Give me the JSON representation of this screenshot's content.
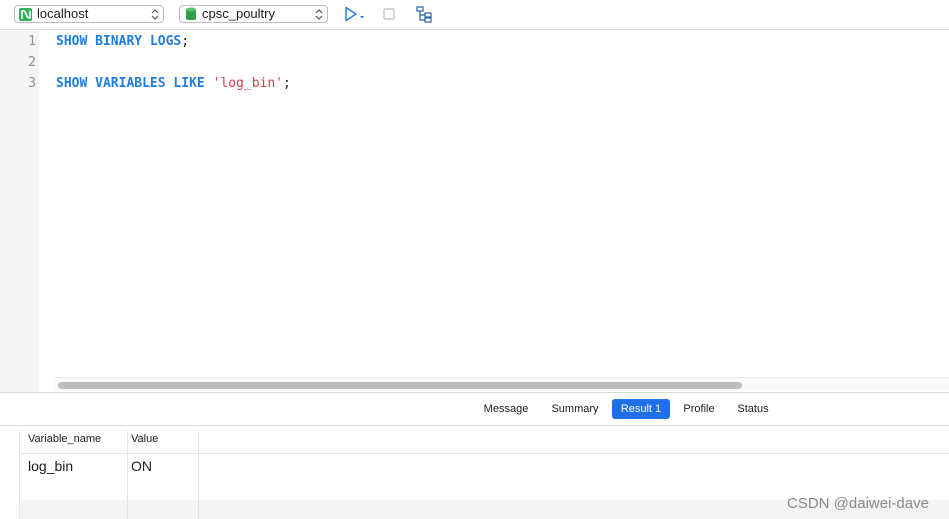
{
  "toolbar": {
    "connection": "localhost",
    "database": "cpsc_poultry",
    "icons": [
      "connection-icon",
      "database-icon",
      "run-icon",
      "stop-icon",
      "explain-icon"
    ]
  },
  "editor": {
    "line_numbers": [
      "1",
      "2",
      "3"
    ],
    "line1": {
      "kw1": "SHOW",
      "kw2": "BINARY",
      "kw3": "LOGS",
      "end": ";"
    },
    "line3": {
      "kw1": "SHOW",
      "kw2": "VARIABLES",
      "kw3": "LIKE",
      "str": "'log_bin'",
      "end": ";"
    }
  },
  "result_tabs": [
    {
      "label": "Message",
      "active": false
    },
    {
      "label": "Summary",
      "active": false
    },
    {
      "label": "Result 1",
      "active": true
    },
    {
      "label": "Profile",
      "active": false
    },
    {
      "label": "Status",
      "active": false
    }
  ],
  "grid": {
    "columns": [
      "Variable_name",
      "Value"
    ],
    "rows": [
      [
        "log_bin",
        "ON"
      ]
    ]
  },
  "watermark": "CSDN @daiwei-dave",
  "colors": {
    "keyword": "#1f7de0",
    "string": "#d5394c",
    "active_tab": "#1f6fe8",
    "connection_icon": "#2eb35a"
  }
}
